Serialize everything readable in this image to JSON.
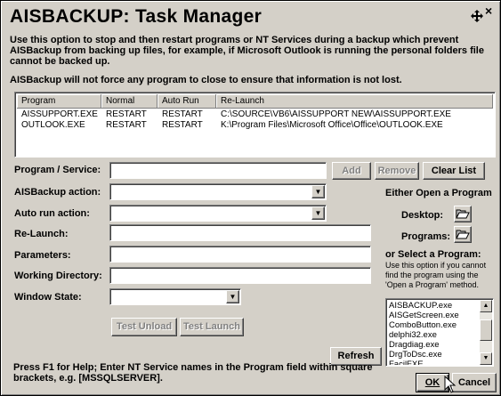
{
  "window": {
    "title": "AISBACKUP: Task Manager",
    "description": "Use this option to stop and then restart programs or NT Services during a backup which prevent AISBackup from backing up files, for example, if Microsoft Outlook is running the personal folders file cannot be backed up.",
    "warning": "AISBackup will not force any program to close to ensure that information is not lost.",
    "close_glyph": "×"
  },
  "task_list": {
    "columns": [
      "Program",
      "Normal",
      "Auto Run",
      "Re-Launch"
    ],
    "rows": [
      [
        "AISSUPPORT.EXE",
        "RESTART",
        "RESTART",
        "C:\\SOURCE\\VB6\\AISSUPPORT NEW\\AISSUPPORT.EXE"
      ],
      [
        "OUTLOOK.EXE",
        "RESTART",
        "RESTART",
        "K:\\Program Files\\Microsoft Office\\Office\\OUTLOOK.EXE"
      ]
    ]
  },
  "form": {
    "program_label": "Program / Service:",
    "program_value": "",
    "aisbackup_action_label": "AISBackup action:",
    "aisbackup_action_value": "",
    "auto_run_action_label": "Auto run action:",
    "auto_run_action_value": "",
    "relaunch_label": "Re-Launch:",
    "relaunch_value": "",
    "parameters_label": "Parameters:",
    "parameters_value": "",
    "working_dir_label": "Working Directory:",
    "working_dir_value": "",
    "window_state_label": "Window State:",
    "window_state_value": ""
  },
  "buttons": {
    "add": "Add",
    "remove": "Remove",
    "clear_list": "Clear List",
    "test_unload": "Test Unload",
    "test_launch": "Test Launch",
    "refresh": "Refresh",
    "ok": "OK",
    "cancel": "Cancel"
  },
  "right_panel": {
    "either_open": "Either Open a Program",
    "desktop_label": "Desktop:",
    "programs_label": "Programs:",
    "or_select": "or Select a Program:",
    "note": "Use this option if you cannot find the program using the 'Open a Program' method.",
    "programs": [
      "AISBACKUP.exe",
      "AISGetScreen.exe",
      "ComboButton.exe",
      "delphi32.exe",
      "Dragdiag.exe",
      "DrgToDsc.exe",
      "FacilFXE"
    ]
  },
  "footer": {
    "help_text": "Press F1 for Help; Enter NT Service names in the Program field within square brackets, e.g. [MSSQLSERVER]."
  },
  "icons": {
    "folder": "folder-open-icon",
    "move": "move-icon",
    "cursor": "mouse-pointer-icon"
  }
}
